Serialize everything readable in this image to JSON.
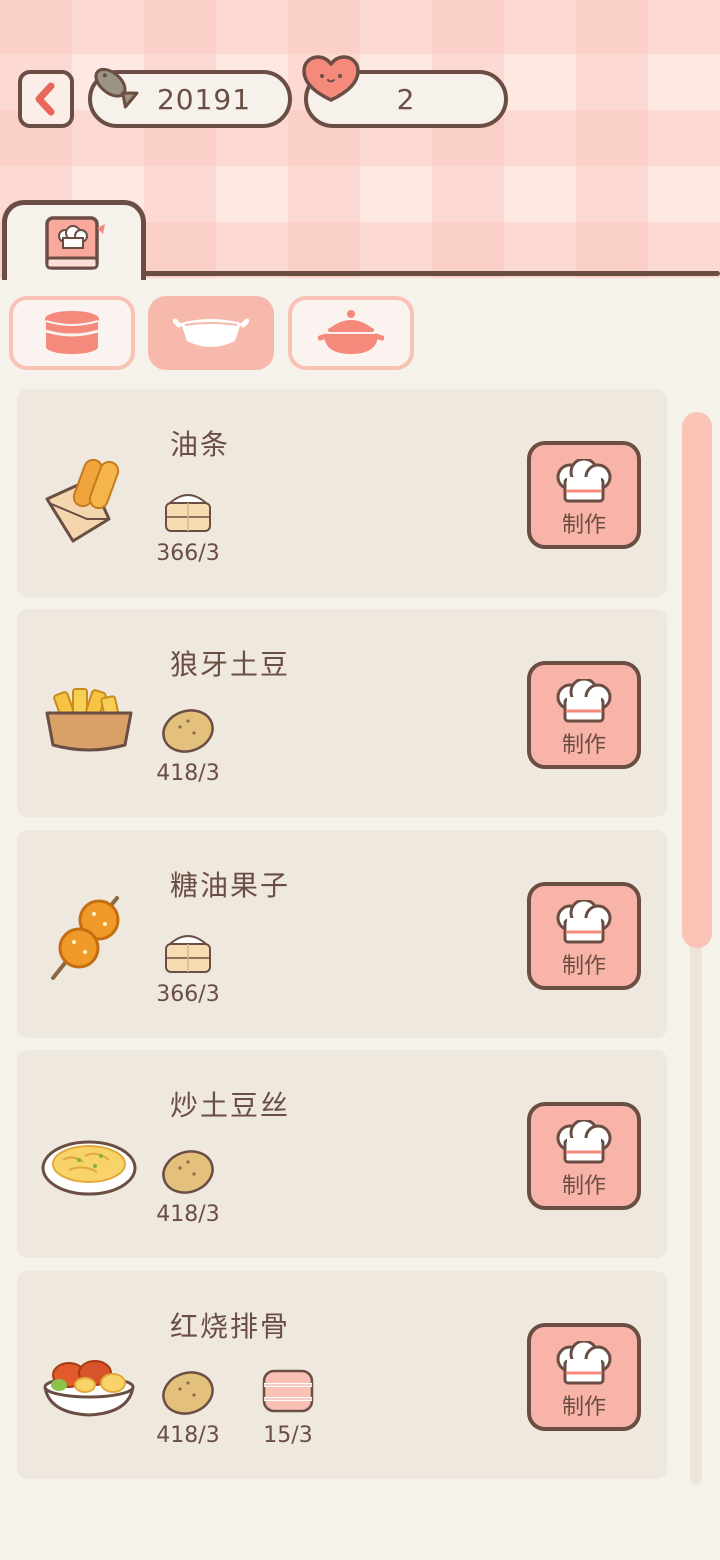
{
  "header": {
    "fish_count": "20191",
    "heart_count": "2"
  },
  "recipes": [
    {
      "name": "油条",
      "dish_icon": "youtiao-dish-icon",
      "ingredients": [
        {
          "icon": "flour-icon",
          "qty": "366/3"
        }
      ],
      "make_label": "制作"
    },
    {
      "name": "狼牙土豆",
      "dish_icon": "wolf-tooth-potato-dish-icon",
      "ingredients": [
        {
          "icon": "potato-icon",
          "qty": "418/3"
        }
      ],
      "make_label": "制作"
    },
    {
      "name": "糖油果子",
      "dish_icon": "sugar-oil-fruit-dish-icon",
      "ingredients": [
        {
          "icon": "flour-icon",
          "qty": "366/3"
        }
      ],
      "make_label": "制作"
    },
    {
      "name": "炒土豆丝",
      "dish_icon": "shredded-potato-dish-icon",
      "ingredients": [
        {
          "icon": "potato-icon",
          "qty": "418/3"
        }
      ],
      "make_label": "制作"
    },
    {
      "name": "红烧排骨",
      "dish_icon": "braised-ribs-dish-icon",
      "ingredients": [
        {
          "icon": "potato-icon",
          "qty": "418/3"
        },
        {
          "icon": "meat-icon",
          "qty": "15/3"
        }
      ],
      "make_label": "制作"
    }
  ],
  "colors": {
    "accent": "#f8b4a8",
    "outline": "#6b4e43",
    "card": "#efe8de"
  }
}
